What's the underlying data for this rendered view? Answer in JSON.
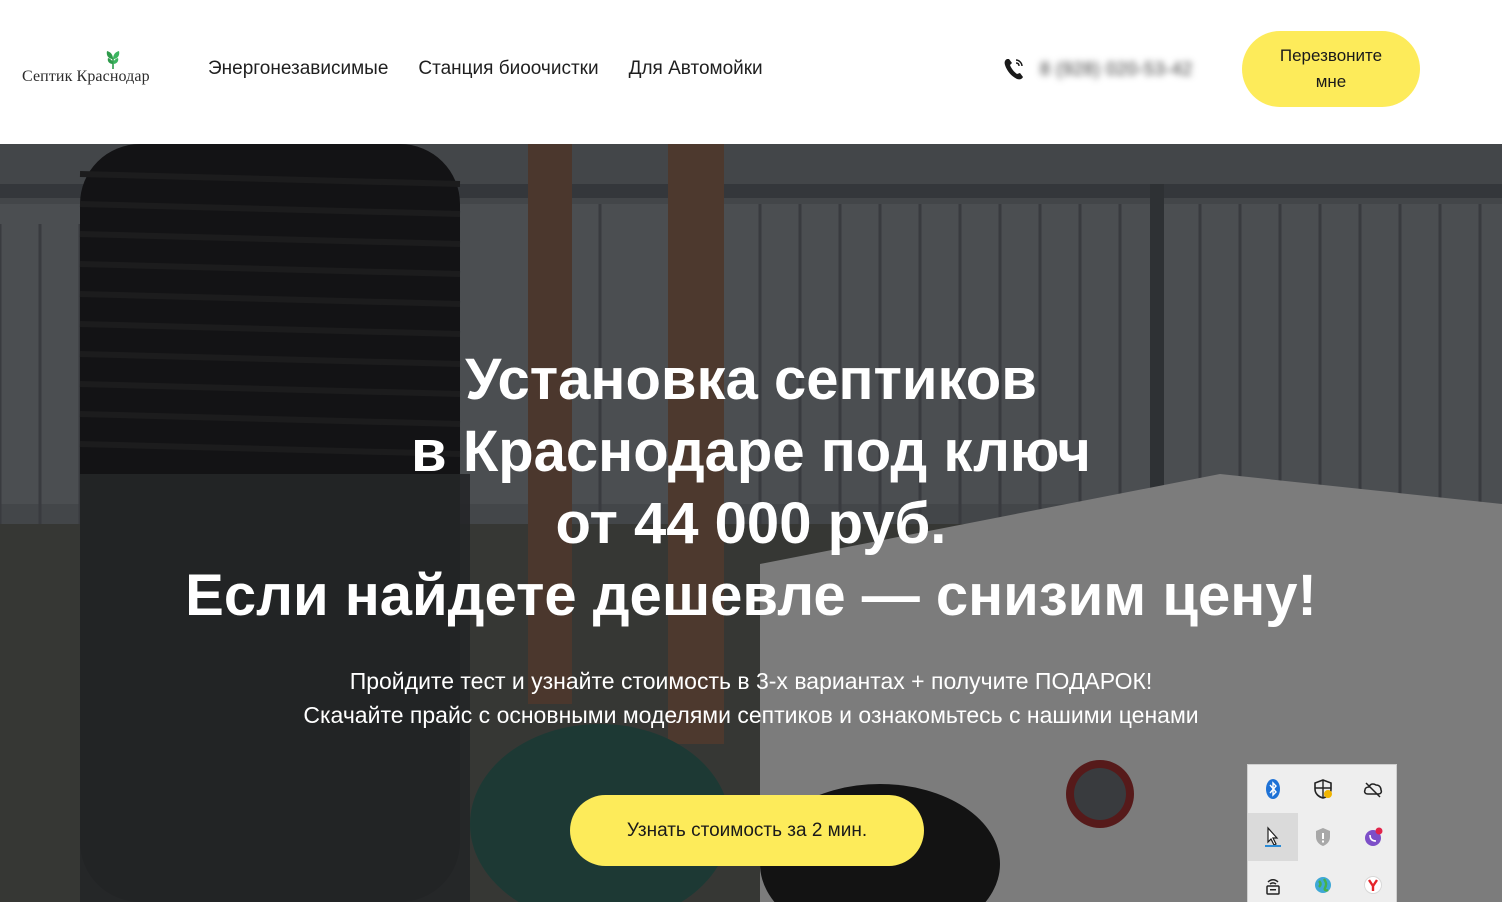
{
  "header": {
    "logo_text": "Септик Краснодар",
    "nav": [
      {
        "label": "Энергонезависимые"
      },
      {
        "label": "Станция биоочистки"
      },
      {
        "label": "Для Автомойки"
      }
    ],
    "phone_number": "8 (928) 020-53-42",
    "callback_label": "Перезвоните мне"
  },
  "hero": {
    "title_lines": [
      "Установка септиков",
      "в Краснодаре под ключ",
      "от 44 000 руб.",
      "Если найдете дешевле — снизим цену!"
    ],
    "subtitle_lines": [
      "Пройдите тест и узнайте стоимость в 3-х вариантах + получите ПОДАРОК!",
      "Скачайте прайс с основными моделями септиков и ознакомьтесь с нашими ценами"
    ],
    "cta_label": "Узнать стоимость за 2 мин."
  },
  "tray": {
    "icons": [
      "bluetooth-icon",
      "security-shield-icon",
      "cloud-offline-icon",
      "cursor-tool-icon",
      "gray-shield-icon",
      "viber-icon",
      "wifi-router-icon",
      "globe-icon",
      "yandex-browser-icon"
    ]
  },
  "colors": {
    "accent_yellow": "#fdeb5a",
    "logo_green": "#2e9b4b",
    "hero_text": "#ffffff"
  }
}
